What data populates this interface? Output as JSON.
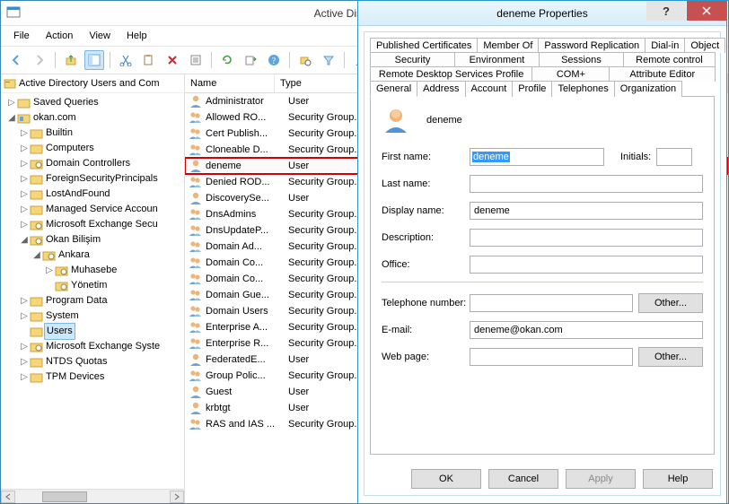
{
  "main": {
    "title": "Active Directory User",
    "header_text": "Active Directory Users and Com",
    "menu": {
      "file": "File",
      "action": "Action",
      "view": "View",
      "help": "Help"
    }
  },
  "tree": {
    "n0": "Saved Queries",
    "n1": "okan.com",
    "n2": "Builtin",
    "n3": "Computers",
    "n4": "Domain Controllers",
    "n5": "ForeignSecurityPrincipals",
    "n6": "LostAndFound",
    "n7": "Managed Service Accoun",
    "n8": "Microsoft Exchange Secu",
    "n9": "Okan Bilişim",
    "n10": "Ankara",
    "n11": "Muhasebe",
    "n12": "Yönetim",
    "n13": "Program Data",
    "n14": "System",
    "n15": "Users",
    "n16": "Microsoft Exchange Syste",
    "n17": "NTDS Quotas",
    "n18": "TPM Devices"
  },
  "list": {
    "cols": {
      "name": "Name",
      "type": "Type"
    },
    "rows": [
      {
        "icon": "user",
        "name": "Administrator",
        "type": "User"
      },
      {
        "icon": "group",
        "name": "Allowed RO...",
        "type": "Security Group."
      },
      {
        "icon": "group",
        "name": "Cert Publish...",
        "type": "Security Group."
      },
      {
        "icon": "group",
        "name": "Cloneable D...",
        "type": "Security Group."
      },
      {
        "icon": "user",
        "name": "deneme",
        "type": "User",
        "selected": true
      },
      {
        "icon": "group",
        "name": "Denied ROD...",
        "type": "Security Group."
      },
      {
        "icon": "user",
        "name": "DiscoverySe...",
        "type": "User"
      },
      {
        "icon": "group",
        "name": "DnsAdmins",
        "type": "Security Group."
      },
      {
        "icon": "group",
        "name": "DnsUpdateP...",
        "type": "Security Group."
      },
      {
        "icon": "group",
        "name": "Domain Ad...",
        "type": "Security Group."
      },
      {
        "icon": "group",
        "name": "Domain Co...",
        "type": "Security Group."
      },
      {
        "icon": "group",
        "name": "Domain Co...",
        "type": "Security Group."
      },
      {
        "icon": "group",
        "name": "Domain Gue...",
        "type": "Security Group."
      },
      {
        "icon": "group",
        "name": "Domain Users",
        "type": "Security Group."
      },
      {
        "icon": "group",
        "name": "Enterprise A...",
        "type": "Security Group."
      },
      {
        "icon": "group",
        "name": "Enterprise R...",
        "type": "Security Group."
      },
      {
        "icon": "user",
        "name": "FederatedE...",
        "type": "User"
      },
      {
        "icon": "group",
        "name": "Group Polic...",
        "type": "Security Group."
      },
      {
        "icon": "user",
        "name": "Guest",
        "type": "User"
      },
      {
        "icon": "user",
        "name": "krbtgt",
        "type": "User"
      },
      {
        "icon": "group",
        "name": "RAS and IAS ...",
        "type": "Security Group."
      }
    ]
  },
  "dialog": {
    "title": "deneme Properties",
    "tabs": {
      "r1": [
        "Published Certificates",
        "Member Of",
        "Password Replication",
        "Dial-in",
        "Object"
      ],
      "r2": [
        "Security",
        "Environment",
        "Sessions",
        "Remote control"
      ],
      "r3": [
        "Remote Desktop Services Profile",
        "COM+",
        "Attribute Editor"
      ],
      "r4": [
        "General",
        "Address",
        "Account",
        "Profile",
        "Telephones",
        "Organization"
      ]
    },
    "user_name": "deneme",
    "labels": {
      "first": "First name:",
      "initials": "Initials:",
      "last": "Last name:",
      "display": "Display name:",
      "desc": "Description:",
      "office": "Office:",
      "phone": "Telephone number:",
      "email": "E-mail:",
      "web": "Web page:",
      "other": "Other..."
    },
    "values": {
      "first": "deneme",
      "initials": "",
      "last": "",
      "display": "deneme",
      "desc": "",
      "office": "",
      "phone": "",
      "email": "deneme@okan.com",
      "web": ""
    },
    "buttons": {
      "ok": "OK",
      "cancel": "Cancel",
      "apply": "Apply",
      "help": "Help"
    }
  }
}
